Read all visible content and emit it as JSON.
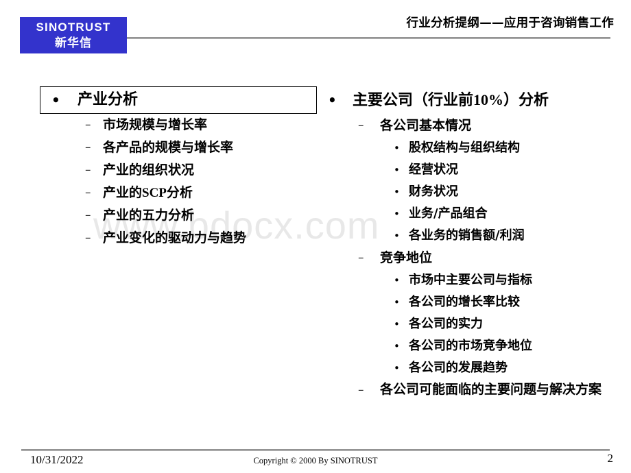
{
  "header": {
    "logo_en": "SINOTRUST",
    "logo_cn": "新华信",
    "title": "行业分析提纲——应用于咨询销售工作",
    "logo_color": "#3333CC",
    "rule_color": "#8A8A8A"
  },
  "watermark": {
    "text": "www.bdocx.com",
    "color": "#E8E8E8"
  },
  "left_column": {
    "title": "产业分析",
    "title_bullet": "•",
    "items": [
      {
        "dash": "–",
        "text": "市场规模与增长率"
      },
      {
        "dash": "–",
        "text": "各产品的规模与增长率"
      },
      {
        "dash": "–",
        "text": "产业的组织状况"
      },
      {
        "dash": "–",
        "text_pre": "产业的",
        "text_mid": "SCP",
        "text_post": "分析"
      },
      {
        "dash": "–",
        "text": "产业的五力分析"
      },
      {
        "dash": "–",
        "text": "产业变化的驱动力与趋势"
      }
    ]
  },
  "right_column": {
    "title_bullet": "•",
    "title_pre": "主要公司（行业前",
    "title_mid": "10%",
    "title_post": "）分析",
    "groups": [
      {
        "dash": "–",
        "label": "各公司基本情况",
        "items": [
          {
            "bullet": "•",
            "text": "股权结构与组织结构"
          },
          {
            "bullet": "•",
            "text": "经营状况"
          },
          {
            "bullet": "•",
            "text": "财务状况"
          },
          {
            "bullet": "•",
            "text": "业务/产品组合"
          },
          {
            "bullet": "•",
            "text": "各业务的销售额/利润"
          }
        ]
      },
      {
        "dash": "–",
        "label": "竞争地位",
        "items": [
          {
            "bullet": "•",
            "text": "市场中主要公司与指标"
          },
          {
            "bullet": "•",
            "text": "各公司的增长率比较"
          },
          {
            "bullet": "•",
            "text": "各公司的实力"
          },
          {
            "bullet": "•",
            "text": "各公司的市场竞争地位"
          },
          {
            "bullet": "•",
            "text": "各公司的发展趋势"
          }
        ]
      },
      {
        "dash": "–",
        "label": "各公司可能面临的主要问题与解决方案",
        "items": []
      }
    ]
  },
  "footer": {
    "date": "10/31/2022",
    "copyright": "Copyright © 2000 By SINOTRUST",
    "page_number": "2"
  }
}
